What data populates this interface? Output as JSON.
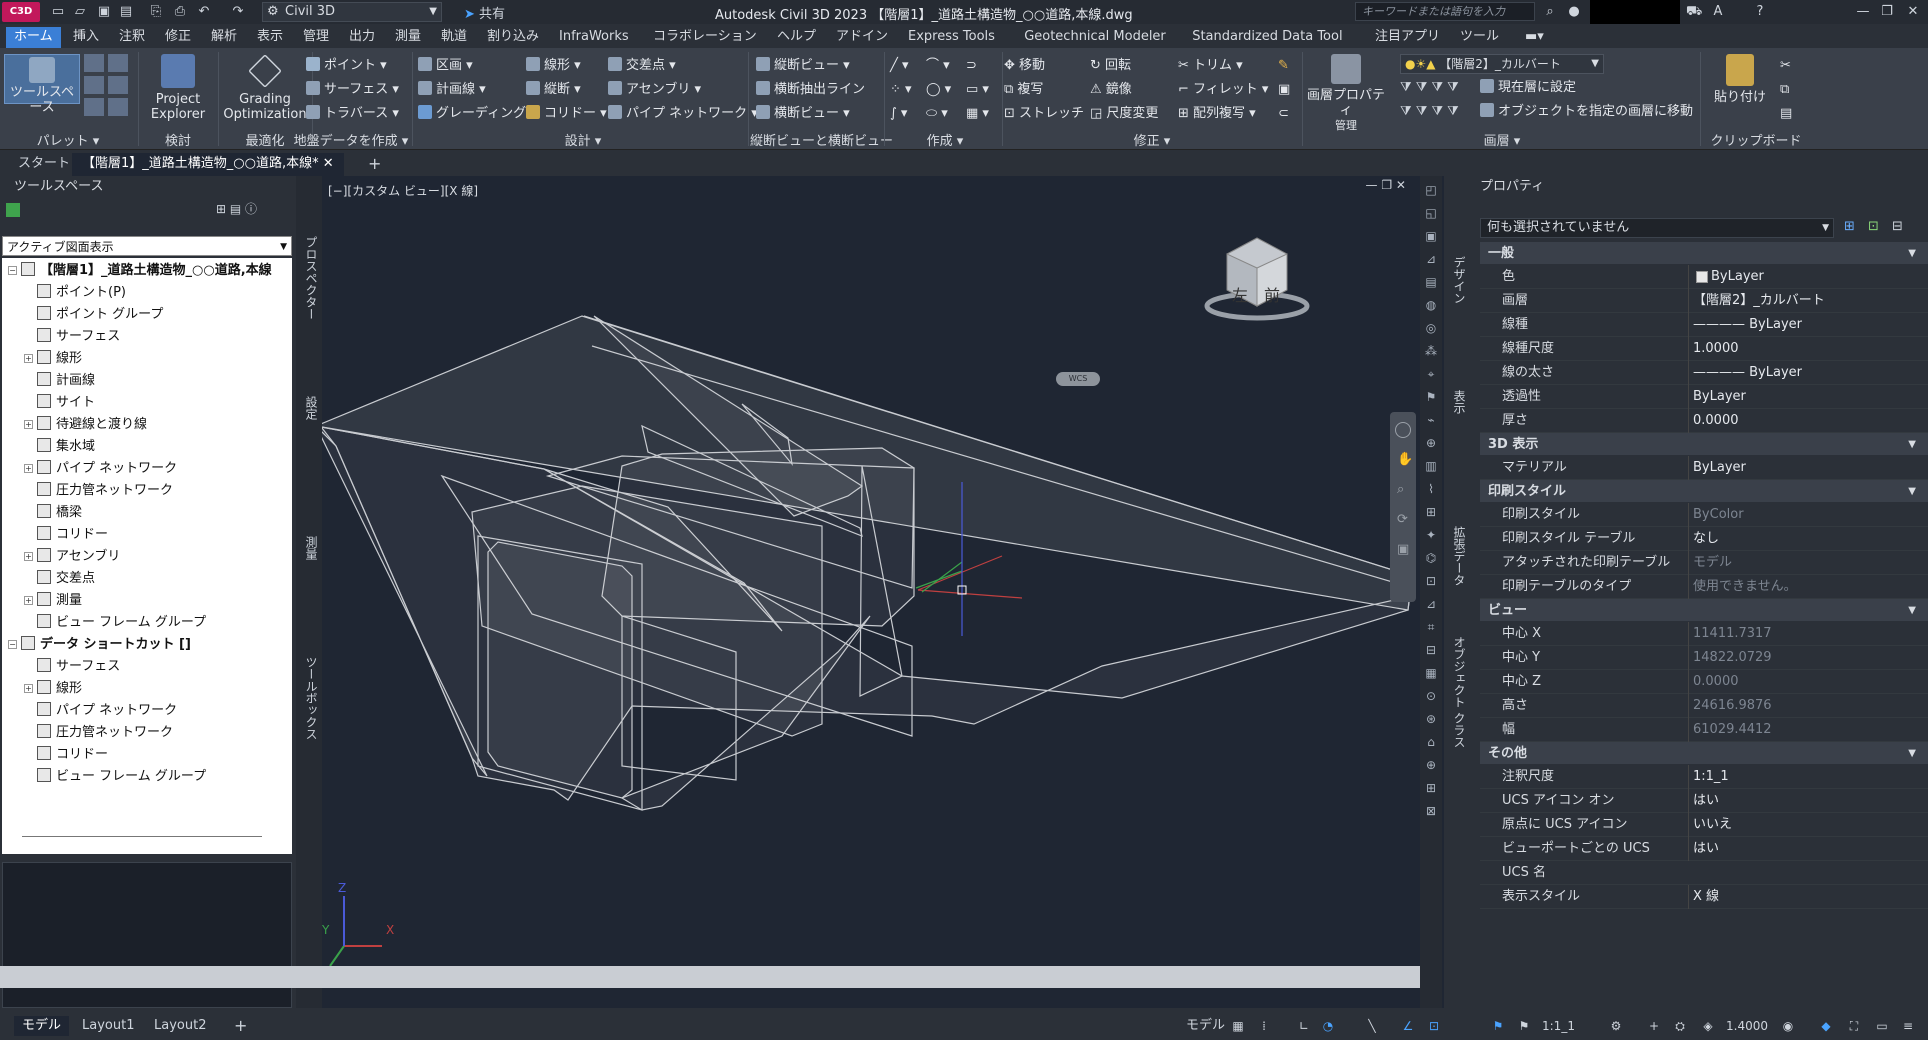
{
  "titlebar": {
    "logo": "C3D",
    "workspace": "Civil 3D",
    "share": "共有",
    "app_title": "Autodesk Civil 3D 2023  【階層1】_道路土構造物_○○道路,本線.dwg",
    "search_placeholder": "キーワードまたは語句を入力"
  },
  "ribbon_tabs": [
    "ホーム",
    "挿入",
    "注釈",
    "修正",
    "解析",
    "表示",
    "管理",
    "出力",
    "測量",
    "軌道",
    "割り込み",
    "InfraWorks",
    "コラボレーション",
    "ヘルプ",
    "アドイン",
    "Express Tools",
    "Geotechnical Modeler",
    "Standardized Data Tool",
    "注目アプリ",
    "ツール"
  ],
  "ribbon": {
    "palette": {
      "btn": "ツールスペース",
      "label": "パレット"
    },
    "review": {
      "btn_line1": "Project",
      "btn_line2": "Explorer",
      "label": "検討"
    },
    "optimize": {
      "btn_line1": "Grading",
      "btn_line2": "Optimization",
      "label": "最適化"
    },
    "ground": {
      "items": [
        "ポイント",
        "サーフェス",
        "トラバース"
      ],
      "label": "地盤データを作成"
    },
    "design": {
      "col1": [
        "区画",
        "計画線",
        "グレーディング"
      ],
      "col2": [
        "線形",
        "縦断",
        "コリドー"
      ],
      "col3": [
        "交差点",
        "アセンブリ",
        "パイプ ネットワーク"
      ],
      "label": "設計"
    },
    "profile": {
      "items": [
        "縦断ビュー",
        "横断抽出ライン",
        "横断ビュー"
      ],
      "label": "縦断ビューと横断ビュー"
    },
    "draw": {
      "label": "作成"
    },
    "modify": {
      "col1": [
        "移動",
        "複写",
        "ストレッチ"
      ],
      "col2": [
        "回転",
        "鏡像",
        "尺度変更"
      ],
      "col3": [
        "トリム",
        "フィレット",
        "配列複写"
      ],
      "label": "修正"
    },
    "layers": {
      "btn_line1": "画層プロパティ",
      "btn_line2": "管理",
      "current": "【階層2】_カルバート",
      "items": [
        "現在層に設定",
        "オブジェクトを指定の画層に移動"
      ],
      "label": "画層"
    },
    "clipboard": {
      "btn": "貼り付け",
      "label": "クリップボード"
    }
  },
  "doc_tabs": {
    "start": "スタート",
    "active": "【階層1】_道路土構造物_○○道路,本線*"
  },
  "toolspace": {
    "title": "ツールスペース",
    "view": "アクティブ図面表示",
    "tree": [
      {
        "text": "【階層1】_道路土構造物_○○道路,本線",
        "level": 0,
        "exp": "−"
      },
      {
        "text": "ポイント(P)",
        "level": 1,
        "exp": ""
      },
      {
        "text": "ポイント グループ",
        "level": 1,
        "exp": ""
      },
      {
        "text": "サーフェス",
        "level": 1,
        "exp": ""
      },
      {
        "text": "線形",
        "level": 1,
        "exp": "+"
      },
      {
        "text": "計画線",
        "level": 1,
        "exp": ""
      },
      {
        "text": "サイト",
        "level": 1,
        "exp": ""
      },
      {
        "text": "待避線と渡り線",
        "level": 1,
        "exp": "+"
      },
      {
        "text": "集水域",
        "level": 1,
        "exp": ""
      },
      {
        "text": "パイプ ネットワーク",
        "level": 1,
        "exp": "+"
      },
      {
        "text": "圧力管ネットワーク",
        "level": 1,
        "exp": ""
      },
      {
        "text": "橋梁",
        "level": 1,
        "exp": ""
      },
      {
        "text": "コリドー",
        "level": 1,
        "exp": ""
      },
      {
        "text": "アセンブリ",
        "level": 1,
        "exp": "+"
      },
      {
        "text": "交差点",
        "level": 1,
        "exp": ""
      },
      {
        "text": "測量",
        "level": 1,
        "exp": "+"
      },
      {
        "text": "ビュー フレーム グループ",
        "level": 1,
        "exp": ""
      },
      {
        "text": "データ ショートカット []",
        "level": 0,
        "exp": "−"
      },
      {
        "text": "サーフェス",
        "level": 1,
        "exp": ""
      },
      {
        "text": "線形",
        "level": 1,
        "exp": "+"
      },
      {
        "text": "パイプ ネットワーク",
        "level": 1,
        "exp": ""
      },
      {
        "text": "圧力管ネットワーク",
        "level": 1,
        "exp": ""
      },
      {
        "text": "コリドー",
        "level": 1,
        "exp": ""
      },
      {
        "text": "ビュー フレーム グループ",
        "level": 1,
        "exp": ""
      }
    ],
    "side_tabs": [
      "プロスペクター",
      "設定",
      "測量",
      "ツールボックス"
    ]
  },
  "viewport": {
    "label": "[−][カスタム ビュー][X 線]",
    "cube_left": "左",
    "cube_front": "前",
    "wcs": "WCS"
  },
  "properties": {
    "title": "プロパティ",
    "selection": "何も選択されていません",
    "side_tabs": [
      "デザイン",
      "表示",
      "拡張データ",
      "オブジェクト クラス"
    ],
    "sections": [
      {
        "name": "一般",
        "rows": [
          [
            "色",
            "ByLayer",
            false
          ],
          [
            "画層",
            "【階層2】_カルバート",
            false
          ],
          [
            "線種",
            "———— ByLayer",
            false
          ],
          [
            "線種尺度",
            "1.0000",
            false
          ],
          [
            "線の太さ",
            "———— ByLayer",
            false
          ],
          [
            "透過性",
            "ByLayer",
            false
          ],
          [
            "厚さ",
            "0.0000",
            false
          ]
        ]
      },
      {
        "name": "3D 表示",
        "rows": [
          [
            "マテリアル",
            "ByLayer",
            false
          ]
        ]
      },
      {
        "name": "印刷スタイル",
        "rows": [
          [
            "印刷スタイル",
            "ByColor",
            true
          ],
          [
            "印刷スタイル テーブル",
            "なし",
            false
          ],
          [
            "アタッチされた印刷テーブル",
            "モデル",
            true
          ],
          [
            "印刷テーブルのタイプ",
            "使用できません。",
            true
          ]
        ]
      },
      {
        "name": "ビュー",
        "rows": [
          [
            "中心 X",
            "11411.7317",
            true
          ],
          [
            "中心 Y",
            "14822.0729",
            true
          ],
          [
            "中心 Z",
            "0.0000",
            true
          ],
          [
            "高さ",
            "24616.9876",
            true
          ],
          [
            "幅",
            "61029.4412",
            true
          ]
        ]
      },
      {
        "name": "その他",
        "rows": [
          [
            "注釈尺度",
            "1:1_1",
            false
          ],
          [
            "UCS アイコン オン",
            "はい",
            false
          ],
          [
            "原点に UCS アイコン",
            "いいえ",
            false
          ],
          [
            "ビューポートごとの UCS",
            "はい",
            false
          ],
          [
            "UCS 名",
            "",
            false
          ],
          [
            "表示スタイル",
            "X 線",
            false
          ]
        ]
      }
    ]
  },
  "statusbar": {
    "tabs": [
      "モデル",
      "Layout1",
      "Layout2"
    ],
    "model": "モデル",
    "scale": "1:1_1",
    "lineweight": "1.4000"
  }
}
